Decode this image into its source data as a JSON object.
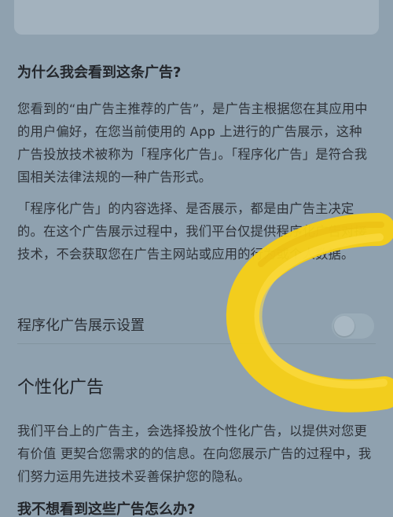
{
  "section1": {
    "heading": "为什么我会看到这条广告?",
    "paragraph1": "您看到的“由广告主推荐的广告”，是广告主根据您在其应用中的用户偏好，在您当前使用的 App 上进行的广告展示，这种广告投放技术被称为「程序化广告」。「程序化广告」是符合我国相关法律法规的一种广告形式。",
    "paragraph2": "「程序化广告」的内容选择、是否展示，都是由广告主决定的。在这个广告展示过程中，我们平台仅提供程序化广告对接技术，不会获取您在广告主网站或应用的行为或个人数据。"
  },
  "setting": {
    "label": "程序化广告展示设置",
    "enabled": false
  },
  "section2": {
    "title": "个性化广告",
    "paragraph": "我们平台上的广告主，会选择投放个性化广告，以提供对您更有价值 更契合您需求的的信息。在向您展示广告的过程中，我们努力运用先进技术妥善保护您的隐私。"
  },
  "section3": {
    "heading": "我不想看到这些广告怎么办?"
  },
  "colors": {
    "background": "#8FA1AF",
    "scribble": "#F6CF17"
  }
}
